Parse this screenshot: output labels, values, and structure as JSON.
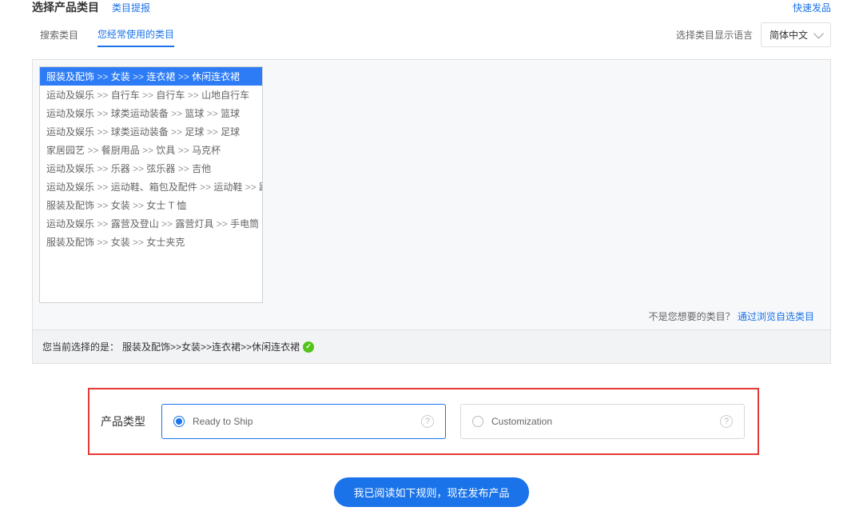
{
  "header": {
    "title": "选择产品类目",
    "sub_link": "类目提报",
    "right_link": "快速发品"
  },
  "tabs": {
    "search": "搜索类目",
    "frequent": "您经常使用的类目"
  },
  "language": {
    "label": "选择类目显示语言",
    "value": "简体中文"
  },
  "categories": [
    [
      [
        "服装及配饰",
        "女装",
        "连衣裙",
        "休闲连衣裙"
      ],
      true
    ],
    [
      [
        "运动及娱乐",
        "自行车",
        "自行车",
        "山地自行车"
      ],
      false
    ],
    [
      [
        "运动及娱乐",
        "球类运动装备",
        "篮球",
        "篮球"
      ],
      false
    ],
    [
      [
        "运动及娱乐",
        "球类运动装备",
        "足球",
        "足球"
      ],
      false
    ],
    [
      [
        "家居园艺",
        "餐厨用品",
        "饮具",
        "马克杯"
      ],
      false
    ],
    [
      [
        "运动及娱乐",
        "乐器",
        "弦乐器",
        "吉他"
      ],
      false
    ],
    [
      [
        "运动及娱乐",
        "运动鞋、箱包及配件",
        "运动鞋",
        "跑步鞋"
      ],
      false
    ],
    [
      [
        "服装及配饰",
        "女装",
        "女士 T 恤"
      ],
      false
    ],
    [
      [
        "运动及娱乐",
        "露营及登山",
        "露营灯具",
        "手电筒"
      ],
      false
    ],
    [
      [
        "服装及配饰",
        "女装",
        "女士夹克"
      ],
      false
    ]
  ],
  "footer_hint": {
    "question": "不是您想要的类目？",
    "link": "通过浏览自选类目"
  },
  "current_selection": {
    "prefix": "您当前选择的是：",
    "path": "服装及配饰>>女装>>连衣裙>>休闲连衣裙"
  },
  "product_type": {
    "label": "产品类型",
    "options": [
      {
        "label": "Ready to Ship",
        "selected": true
      },
      {
        "label": "Customization",
        "selected": false
      }
    ]
  },
  "publish_button": "我已阅读如下规则，现在发布产品"
}
